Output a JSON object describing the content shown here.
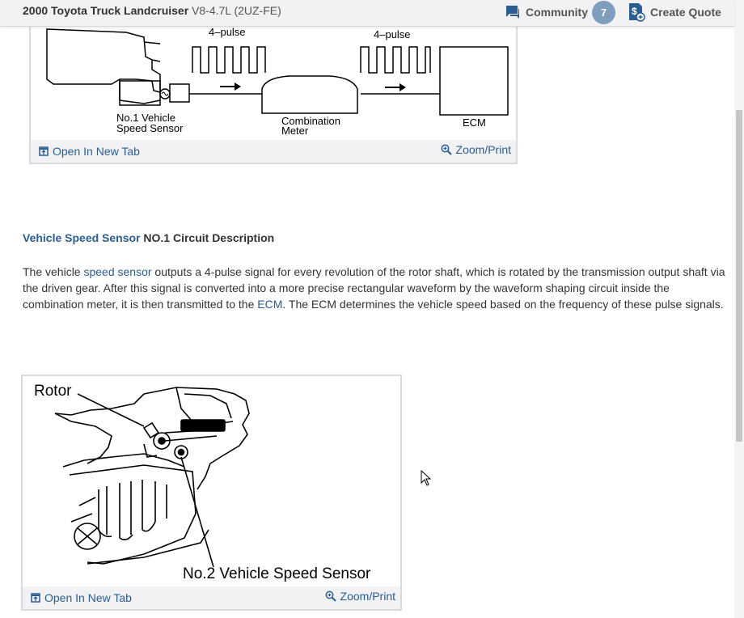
{
  "header": {
    "vehicle_name": "2000 Toyota Truck Landcruiser",
    "vehicle_engine": "V8-4.7L (2UZ-FE)",
    "community_label": "Community",
    "community_count": "7",
    "quote_label": "Create Quote"
  },
  "figure1": {
    "pulse_left": "4–pulse",
    "pulse_right": "4–pulse",
    "sensor_line1": "No.1 Vehicle",
    "sensor_line2": "Speed Sensor",
    "meter_line1": "Combination",
    "meter_line2": "Meter",
    "ecm": "ECM",
    "open_label": "Open In New Tab",
    "zoom_label": "Zoom/Print"
  },
  "section": {
    "title_link": "Vehicle Speed Sensor",
    "title_rest": " NO.1 Circuit Description",
    "p1": "The vehicle ",
    "link1": "speed sensor",
    "p2": " outputs a 4-pulse signal for every revolution of the rotor shaft, which is rotated by the transmission output shaft via the driven gear. After this signal is converted into a more precise rectangular waveform by the waveform shaping circuit inside the combination meter, it is then transmitted to the ",
    "link2": "ECM",
    "p3": ". The ECM determines the vehicle speed based on the frequency of these pulse signals."
  },
  "figure2": {
    "rotor_label": "Rotor",
    "sensor_label": "No.2 Vehicle Speed Sensor",
    "open_label": "Open In New Tab",
    "zoom_label": "Zoom/Print"
  },
  "colors": {
    "link": "#2a5d91",
    "badge": "#7f9dbd",
    "bar": "#f2f2f4"
  },
  "icons": [
    "comment-icon",
    "dollar-quote-icon",
    "open-new-tab-icon",
    "zoom-icon",
    "mouse-cursor-icon"
  ]
}
